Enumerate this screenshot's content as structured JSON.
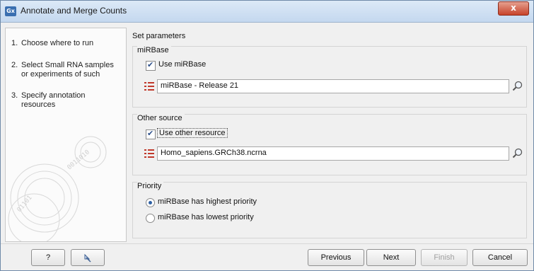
{
  "window": {
    "title": "Annotate and Merge Counts",
    "app_icon": "Gx",
    "close_label": "x"
  },
  "steps": [
    {
      "num": "1.",
      "label": "Choose where to run"
    },
    {
      "num": "2.",
      "label": "Select Small RNA samples or experiments of such"
    },
    {
      "num": "3.",
      "label": "Specify annotation resources"
    }
  ],
  "main": {
    "heading": "Set parameters",
    "mirbase": {
      "group_label": "miRBase",
      "checkbox_label": "Use miRBase",
      "checked": true,
      "field_value": "miRBase - Release 21"
    },
    "other": {
      "group_label": "Other source",
      "checkbox_label": "Use other resource",
      "checked": true,
      "field_value": "Homo_sapiens.GRCh38.ncrna"
    },
    "priority": {
      "group_label": "Priority",
      "options": [
        {
          "label": "miRBase has highest priority",
          "selected": true
        },
        {
          "label": "miRBase has lowest priority",
          "selected": false
        }
      ]
    }
  },
  "buttons": {
    "help": "?",
    "previous": "Previous",
    "next": "Next",
    "finish": "Finish",
    "cancel": "Cancel"
  },
  "colors": {
    "accent": "#3a6fb0",
    "list_icon": "#c0392b"
  }
}
